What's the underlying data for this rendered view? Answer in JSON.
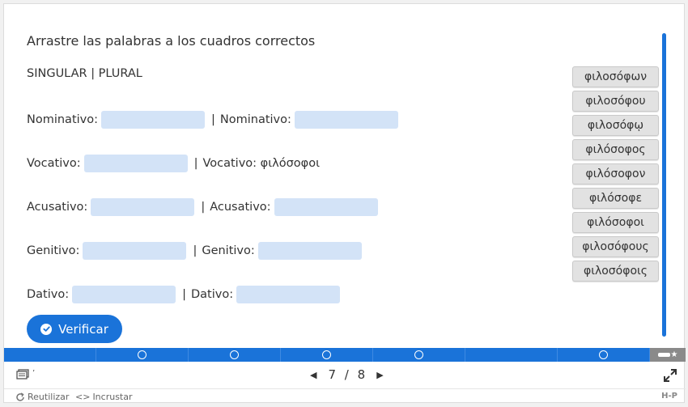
{
  "task_description": "Arrastre las palabras a los cuadros correctos",
  "header_row": "SINGULAR | PLURAL",
  "rows": [
    {
      "singular_label": "Nominativo:",
      "separator": "|",
      "plural_label": "Nominativo:",
      "plural_value": ""
    },
    {
      "singular_label": "Vocativo:",
      "separator": "|",
      "plural_label": "Vocativo: φιλόσοφοι",
      "plural_value": ""
    },
    {
      "singular_label": "Acusativo:",
      "separator": "|",
      "plural_label": "Acusativo:",
      "plural_value": ""
    },
    {
      "singular_label": "Genitivo:",
      "separator": "|",
      "plural_label": "Genitivo:",
      "plural_value": ""
    },
    {
      "singular_label": "Dativo:",
      "separator": "|",
      "plural_label": "Dativo:",
      "plural_value": ""
    }
  ],
  "word_bank": [
    "φιλοσόφων",
    "φιλοσόφου",
    "φιλοσόφῳ",
    "φιλόσοφος",
    "φιλόσοφον",
    "φιλόσοφε",
    "φιλόσοφοι",
    "φιλοσόφους",
    "φιλοσόφοις"
  ],
  "verify_button": "Verificar",
  "pager": {
    "current": "7",
    "divider": "/",
    "total": "8"
  },
  "footer": {
    "reuse": "Reutilizar",
    "embed": "Incrustar",
    "embed_prefix": "<>",
    "brand": "H-P"
  },
  "colors": {
    "accent": "#1a73d9",
    "drop_zone": "#d3e3f7",
    "draggable": "#e2e2e2"
  }
}
